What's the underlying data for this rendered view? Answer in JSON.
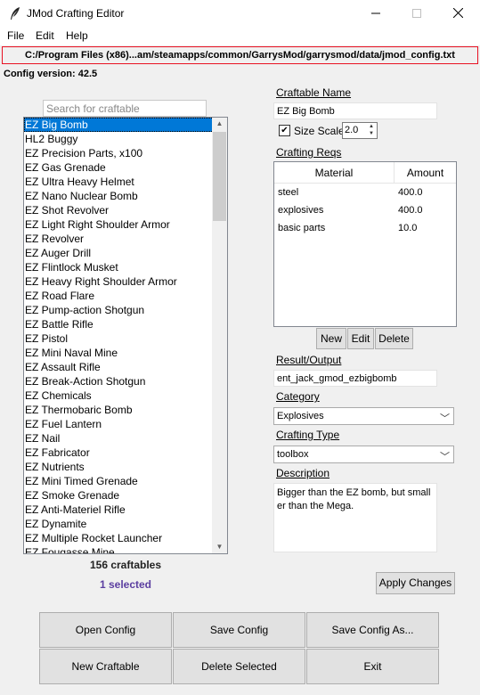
{
  "window": {
    "title": "JMod Crafting Editor",
    "minimize_icon": "minimize-icon",
    "maximize_icon": "maximize-icon",
    "close_icon": "close-icon"
  },
  "menu": {
    "file": "File",
    "edit": "Edit",
    "help": "Help"
  },
  "config": {
    "path": "C:/Program Files (x86)...am/steamapps/common/GarrysMod/garrysmod/data/jmod_config.txt",
    "version": "Config version: 42.5"
  },
  "search": {
    "placeholder": "Search for craftable",
    "value": ""
  },
  "craftables": {
    "selected_index": 0,
    "items": [
      "EZ Big Bomb",
      "HL2 Buggy",
      "EZ Precision Parts, x100",
      "EZ Gas Grenade",
      "EZ Ultra Heavy Helmet",
      "EZ Nano Nuclear Bomb",
      "EZ Shot Revolver",
      "EZ Light Right Shoulder Armor",
      "EZ Revolver",
      "EZ Auger Drill",
      "EZ Flintlock Musket",
      "EZ Heavy Right Shoulder Armor",
      "EZ Road Flare",
      "EZ Pump-action Shotgun",
      "EZ Battle Rifle",
      "EZ Pistol",
      "EZ Mini Naval Mine",
      "EZ Assault Rifle",
      "EZ Break-Action Shotgun",
      "EZ Chemicals",
      "EZ Thermobaric Bomb",
      "EZ Fuel Lantern",
      "EZ Nail",
      "EZ Fabricator",
      "EZ Nutrients",
      "EZ Mini Timed Grenade",
      "EZ Smoke Grenade",
      "EZ Anti-Materiel Rifle",
      "EZ Dynamite",
      "EZ Multiple Rocket Launcher",
      "EZ Fougasse Mine"
    ],
    "count_text": "156 craftables",
    "selected_text": "1 selected"
  },
  "details": {
    "name_label": "Craftable Name",
    "name_value": "EZ Big Bomb",
    "size_scale_checked": true,
    "size_scale_label": "Size Scale",
    "size_scale_value": "2.0",
    "reqs_label": "Crafting Reqs",
    "reqs_columns": {
      "material": "Material",
      "amount": "Amount"
    },
    "reqs": [
      {
        "material": "steel",
        "amount": "400.0"
      },
      {
        "material": "explosives",
        "amount": "400.0"
      },
      {
        "material": "basic parts",
        "amount": "10.0"
      }
    ],
    "btn_new": "New",
    "btn_edit": "Edit",
    "btn_delete": "Delete",
    "result_label": "Result/Output",
    "result_value": "ent_jack_gmod_ezbigbomb",
    "category_label": "Category",
    "category_value": "Explosives",
    "crafting_type_label": "Crafting Type",
    "crafting_type_value": "toolbox",
    "description_label": "Description",
    "description_value": "Bigger than the EZ bomb, but smaller than the Mega.",
    "apply_button": "Apply Changes"
  },
  "actions": {
    "open_config": "Open Config",
    "save_config": "Save Config",
    "save_config_as": "Save Config As...",
    "new_craftable": "New Craftable",
    "delete_selected": "Delete Selected",
    "exit": "Exit"
  },
  "colors": {
    "selection": "#0078d7",
    "selected_count": "#5b3ea0",
    "path_border": "#e81123"
  }
}
